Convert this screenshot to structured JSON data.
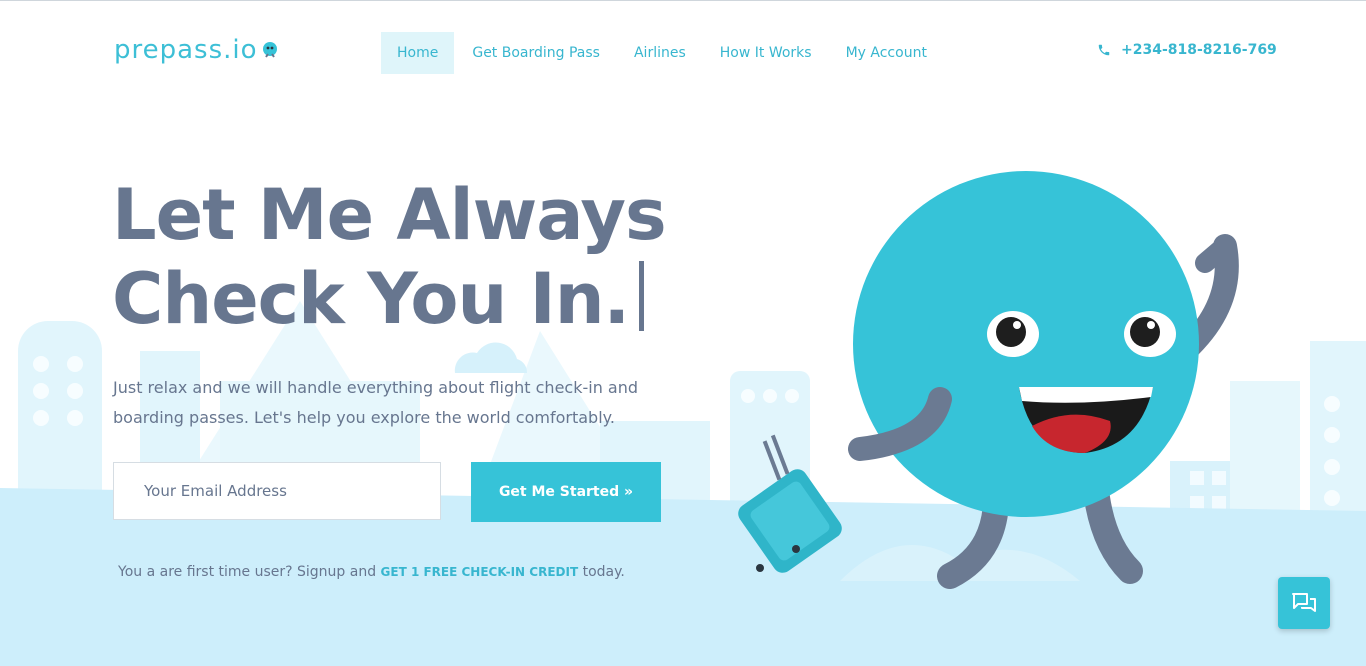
{
  "header": {
    "logo_text": "prepass.io",
    "nav": [
      {
        "label": "Home",
        "active": true
      },
      {
        "label": "Get Boarding Pass",
        "active": false
      },
      {
        "label": "Airlines",
        "active": false
      },
      {
        "label": "How It Works",
        "active": false
      },
      {
        "label": "My Account",
        "active": false
      }
    ],
    "phone": "+234-818-8216-769"
  },
  "hero": {
    "title_line1": "Let Me Always",
    "title_line2": "Check You In.",
    "subtitle": "Just relax and we will handle everything about flight check-in and boarding passes. Let's help you explore the world comfortably.",
    "email_placeholder": "Your Email Address",
    "cta_label": "Get Me Started »",
    "signup_prefix": "You a are first time user? Signup and",
    "signup_link": "GET 1 FREE CHECK-IN CREDIT",
    "signup_suffix": "today."
  },
  "icons": {
    "phone": "phone-icon",
    "chat": "chat-icon",
    "mascot": "mascot-illustration"
  },
  "colors": {
    "accent": "#36c3d8",
    "text": "#67768f",
    "sky": "#cdeefb"
  }
}
